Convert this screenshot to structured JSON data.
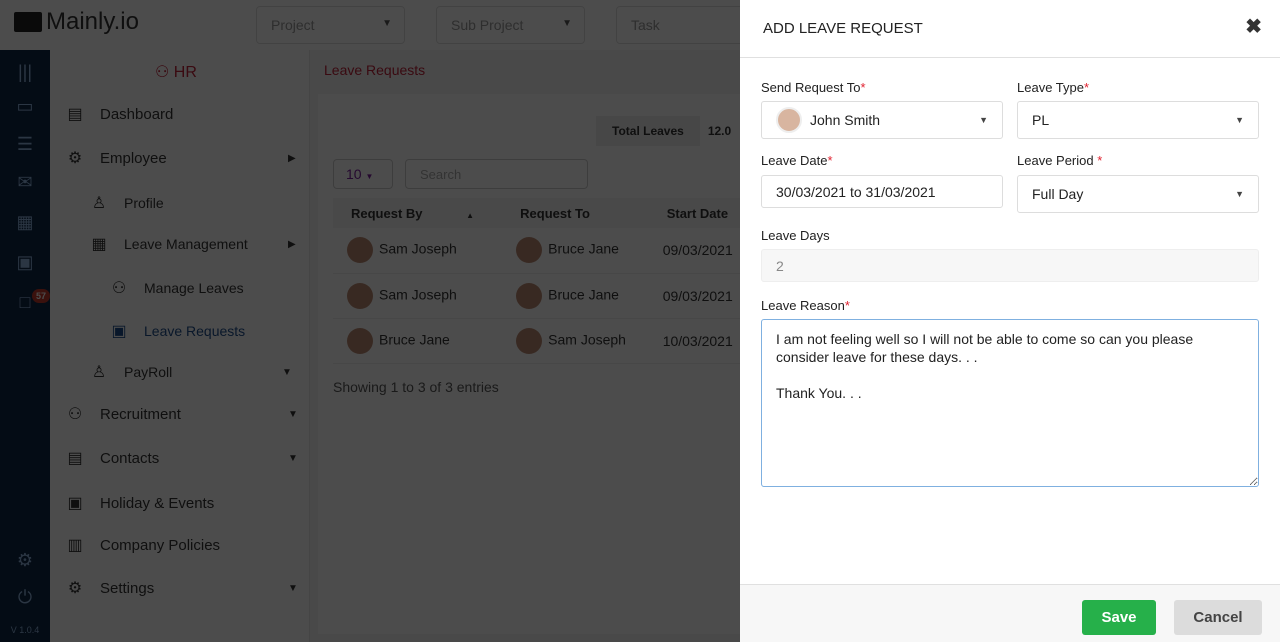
{
  "app": {
    "logo": "Mainly.io",
    "version": "V 1.0.4",
    "module": "HR"
  },
  "topbar": {
    "project": "Project",
    "sub_project": "Sub Project",
    "task": "Task"
  },
  "iconbar": {
    "notification_count": "57"
  },
  "sidebar": {
    "items": [
      {
        "label": "Dashboard",
        "icon": "dashboard-icon"
      },
      {
        "label": "Employee",
        "icon": "gear-icon"
      },
      {
        "label": "Profile",
        "icon": "user-icon"
      },
      {
        "label": "Leave Management",
        "icon": "calendar-icon"
      },
      {
        "label": "Manage Leaves",
        "icon": "user-clock-icon"
      },
      {
        "label": "Leave Requests",
        "icon": "id-card-icon"
      },
      {
        "label": "PayRoll",
        "icon": "user-dollar-icon"
      },
      {
        "label": "Recruitment",
        "icon": "users-icon"
      },
      {
        "label": "Contacts",
        "icon": "contacts-icon"
      },
      {
        "label": "Holiday & Events",
        "icon": "calendar-event-icon"
      },
      {
        "label": "Company Policies",
        "icon": "clipboard-icon"
      },
      {
        "label": "Settings",
        "icon": "settings-icon"
      }
    ]
  },
  "page": {
    "breadcrumb": "Leave Requests",
    "total_leaves_label": "Total Leaves",
    "total_leaves_value": "12.0",
    "page_length": "10",
    "search_placeholder": "Search",
    "columns": [
      "Request By",
      "Request To",
      "Start Date"
    ],
    "rows": [
      [
        "Sam Joseph",
        "Bruce Jane",
        "09/03/2021"
      ],
      [
        "Sam Joseph",
        "Bruce Jane",
        "09/03/2021"
      ],
      [
        "Bruce Jane",
        "Sam Joseph",
        "10/03/2021"
      ]
    ],
    "info": "Showing 1 to 3 of 3 entries"
  },
  "modal": {
    "title": "ADD LEAVE REQUEST",
    "send_to_label": "Send Request To",
    "send_to_value": "John Smith",
    "leave_type_label": "Leave Type",
    "leave_type_value": "PL",
    "leave_date_label": "Leave Date",
    "leave_date_value": "30/03/2021 to 31/03/2021",
    "leave_period_label": "Leave Period",
    "leave_period_value": "Full Day",
    "leave_days_label": "Leave Days",
    "leave_days_value": "2",
    "reason_label": "Leave Reason",
    "reason_value": "I am not feeling well so I will not be able to come so can you please consider leave for these days. . .\n\nThank You. . .",
    "required_mark": "*",
    "save": "Save",
    "cancel": "Cancel"
  },
  "colors": {
    "accent_red": "#c0223a",
    "save_green": "#26b04a",
    "iconbar_navy": "#0d2746"
  }
}
